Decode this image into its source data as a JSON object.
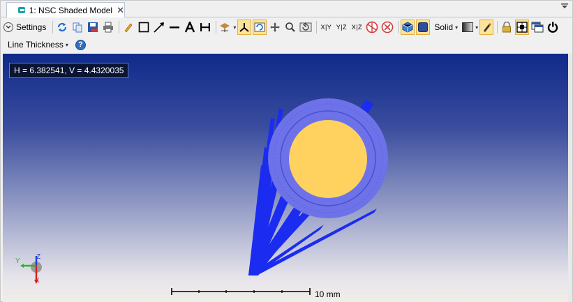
{
  "tab": {
    "title": "1: NSC Shaded Model",
    "close": "✕"
  },
  "toolbar": {
    "settings_label": "Settings",
    "solid_label": "Solid",
    "axis_buttons": [
      "X|Y",
      "Y|Z",
      "X|Z"
    ]
  },
  "toolbar2": {
    "line_thickness_label": "Line Thickness",
    "help": "?"
  },
  "viewport": {
    "coord_readout": "H = 6.382541, V = 4.4320035",
    "scale_label": "10 mm",
    "axis_labels": {
      "y": "Y",
      "z": "Z",
      "x": "X"
    }
  },
  "colors": {
    "accent_active": "#fbe39a",
    "rays": "#1b2cf0",
    "lens_ring": "#6d72e8",
    "lens_core": "#ffd260"
  }
}
